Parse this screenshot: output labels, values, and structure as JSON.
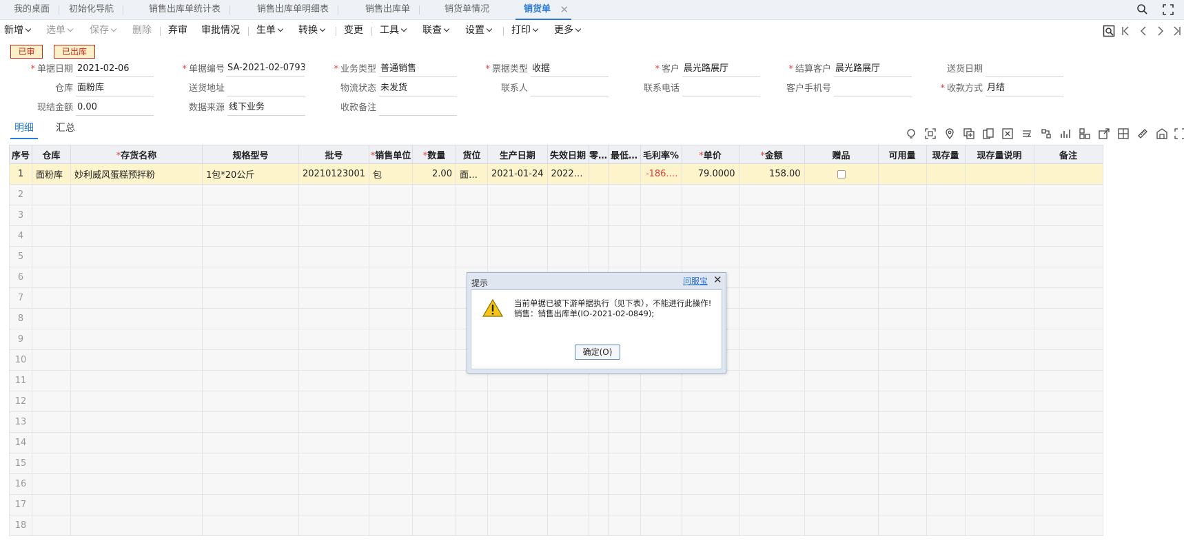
{
  "tabs": [
    {
      "label": "我的桌面"
    },
    {
      "label": "初始化导航"
    },
    {
      "label": "销售出库单统计表"
    },
    {
      "label": "销售出库单明细表"
    },
    {
      "label": "销售出库单"
    },
    {
      "label": "销货单情况"
    },
    {
      "label": "销货单",
      "active": true
    }
  ],
  "toolbar": {
    "new": "新增",
    "select": "选单",
    "save": "保存",
    "delete": "删除",
    "abandon": "弃审",
    "approval": "审批情况",
    "generate": "生单",
    "convert": "转换",
    "change": "变更",
    "tools": "工具",
    "linked_query": "联查",
    "settings": "设置",
    "print": "打印",
    "more": "更多"
  },
  "stamps": {
    "approved": "已审",
    "outbound": "已出库"
  },
  "form": {
    "doc_date_label": "单据日期",
    "doc_date": "2021-02-06",
    "doc_no_label": "单据编号",
    "doc_no": "SA-2021-02-0793",
    "biz_type_label": "业务类型",
    "biz_type": "普通销售",
    "invoice_type_label": "票据类型",
    "invoice_type": "收据",
    "customer_label": "客户",
    "customer": "晨光路展厅",
    "settle_customer_label": "结算客户",
    "settle_customer": "晨光路展厅",
    "delivery_date_label": "送货日期",
    "delivery_date": "",
    "warehouse_label": "仓库",
    "warehouse": "面粉库",
    "delivery_addr_label": "送货地址",
    "delivery_addr": "",
    "logistics_label": "物流状态",
    "logistics": "未发货",
    "contact_label": "联系人",
    "contact": "",
    "phone_label": "联系电话",
    "phone": "",
    "mobile_label": "客户手机号",
    "mobile": "",
    "payment_label": "收款方式",
    "payment": "月结",
    "cash_label": "现结金额",
    "cash": "0.00",
    "source_label": "数据来源",
    "source": "线下业务",
    "remark_label": "收款备注",
    "remark": ""
  },
  "subtabs": {
    "detail": "明细",
    "summary": "汇总"
  },
  "grid": {
    "headers": [
      "序号",
      "仓库",
      "存货名称",
      "规格型号",
      "批号",
      "销售单位",
      "数量",
      "货位",
      "生产日期",
      "失效日期",
      "零…",
      "最低…",
      "毛利率%",
      "单价",
      "金额",
      "赠品",
      "可用量",
      "现存量",
      "现存量说明",
      "备注"
    ],
    "row": {
      "idx": "1",
      "warehouse": "面粉库",
      "item": "妙利威风蛋糕预拌粉",
      "spec": "1包*20公斤",
      "batch": "20210123001",
      "unit": "包",
      "qty": "2.00",
      "location": "面…",
      "mfg_date": "2021-01-24",
      "exp_date": "2022…",
      "zero": "",
      "min": "",
      "margin": "-186.…",
      "price": "79.0000",
      "amount": "158.00"
    },
    "empty_rows": [
      "2",
      "3",
      "4",
      "5",
      "6",
      "7",
      "8",
      "9",
      "10",
      "11",
      "12",
      "13",
      "14",
      "15",
      "16",
      "17",
      "18"
    ]
  },
  "dialog": {
    "title": "提示",
    "help": "问服宝",
    "message_line1": "当前单据已被下游单据执行（见下表），不能进行此操作!",
    "message_line2": "销售：销售出库单(IO-2021-02-0849);",
    "ok": "确定(O)"
  }
}
